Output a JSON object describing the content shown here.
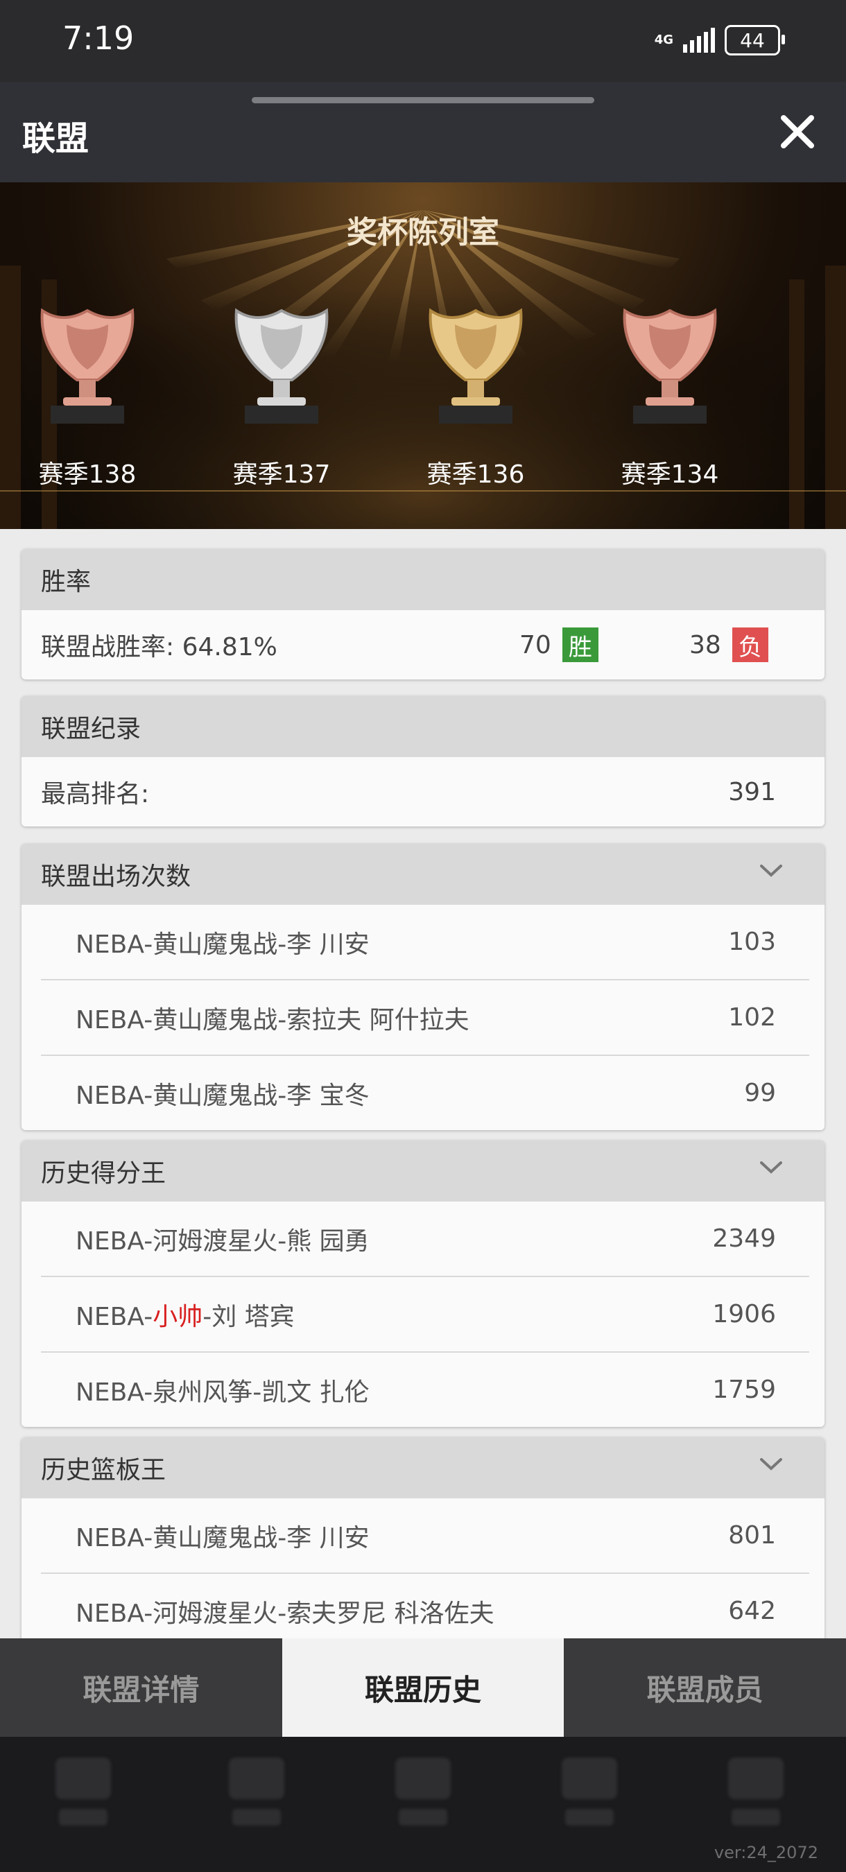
{
  "status_bar": {
    "time": "7:19",
    "network": "4G",
    "battery": "44"
  },
  "header": {
    "title": "联盟"
  },
  "trophy_hall": {
    "title": "奖杯陈列室",
    "trophies": [
      {
        "label": "赛季138",
        "medal": "bronze"
      },
      {
        "label": "赛季137",
        "medal": "silver"
      },
      {
        "label": "赛季136",
        "medal": "gold"
      },
      {
        "label": "赛季134",
        "medal": "bronze"
      }
    ]
  },
  "win_rate": {
    "title": "胜率",
    "label": "联盟战胜率: 64.81%",
    "wins": "70",
    "win_badge": "胜",
    "losses": "38",
    "loss_badge": "负",
    "colors": {
      "win": "#3a9a3a",
      "loss": "#e05050"
    }
  },
  "record": {
    "title": "联盟纪录",
    "best_rank_label": "最高排名:",
    "best_rank_value": "391"
  },
  "appearances": {
    "title": "联盟出场次数",
    "rows": [
      {
        "name": "NEBA-黄山魔鬼战-李 川安",
        "value": "103"
      },
      {
        "name": "NEBA-黄山魔鬼战-索拉夫 阿什拉夫",
        "value": "102"
      },
      {
        "name": "NEBA-黄山魔鬼战-李 宝冬",
        "value": "99"
      }
    ]
  },
  "scorers": {
    "title": "历史得分王",
    "rows": [
      {
        "name": "NEBA-河姆渡星火-熊 园勇",
        "value": "2349"
      },
      {
        "prefix": "NEBA-",
        "team": "小帅",
        "suffix": "-刘 塔宾",
        "value": "1906"
      },
      {
        "name": "NEBA-泉州风筝-凯文 扎伦",
        "value": "1759"
      }
    ]
  },
  "rebounders": {
    "title": "历史篮板王",
    "rows": [
      {
        "name": "NEBA-黄山魔鬼战-李 川安",
        "value": "801"
      },
      {
        "name": "NEBA-河姆渡星火-索夫罗尼 科洛佐夫",
        "value": "642"
      }
    ]
  },
  "tabs": [
    "联盟详情",
    "联盟历史",
    "联盟成员"
  ],
  "version": "ver:24_2072"
}
